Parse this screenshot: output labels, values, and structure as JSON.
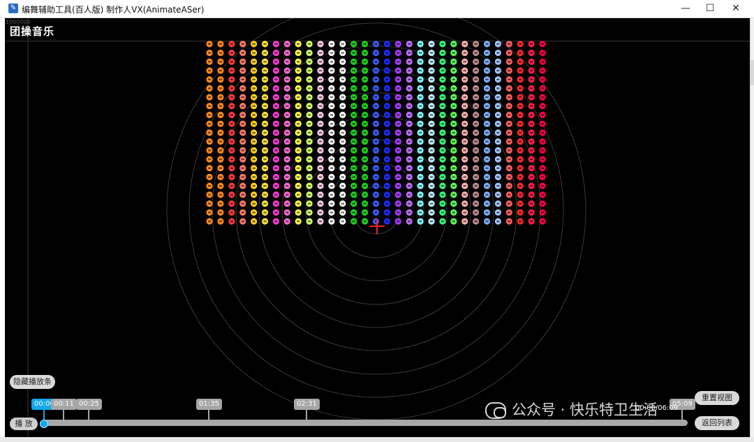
{
  "window": {
    "title": "编舞辅助工具(百人版)  制作人VX(AnimateASer)",
    "icon": "app-icon",
    "minimize": "—",
    "maximize": "☐",
    "close": "✕"
  },
  "stage": {
    "song_title": "团操音乐",
    "corner_label": "1000000",
    "background": "#000000",
    "grid_color": "#3a3a3a"
  },
  "formation": {
    "columns": 31,
    "rows": 21,
    "column_colors": [
      "#ff8a1e",
      "#ff8a1e",
      "#ff3b3b",
      "#ff7a6a",
      "#ffd21e",
      "#ffe43a",
      "#ff3bd8",
      "#ff6ad8",
      "#ffff44",
      "#d8ff6a",
      "#ffc8e8",
      "#ffffff",
      "#ffffff",
      "#1fd11f",
      "#1fd11f",
      "#3b5bff",
      "#1e2cff",
      "#a83bff",
      "#c070ff",
      "#7fffff",
      "#bfefff",
      "#34ff7a",
      "#5bff5b",
      "#ffb0b0",
      "#c08a8a",
      "#7fb0ff",
      "#a6c4ff",
      "#ff6060",
      "#ff2a2a",
      "#ff1e4a",
      "#ff0040"
    ]
  },
  "controls": {
    "hide_bar_label": "隐藏播放条",
    "play_label": "播 放",
    "reset_view_label": "重置视图",
    "back_list_label": "返回列表",
    "progress": 0.0
  },
  "timeline": {
    "markers": [
      "00:00",
      "00:11",
      "00:25",
      "01:35",
      "02:31",
      "05:09"
    ],
    "current_readout": "00:00/06:09"
  },
  "watermark": {
    "text": "公众号 · 快乐特卫生活"
  }
}
